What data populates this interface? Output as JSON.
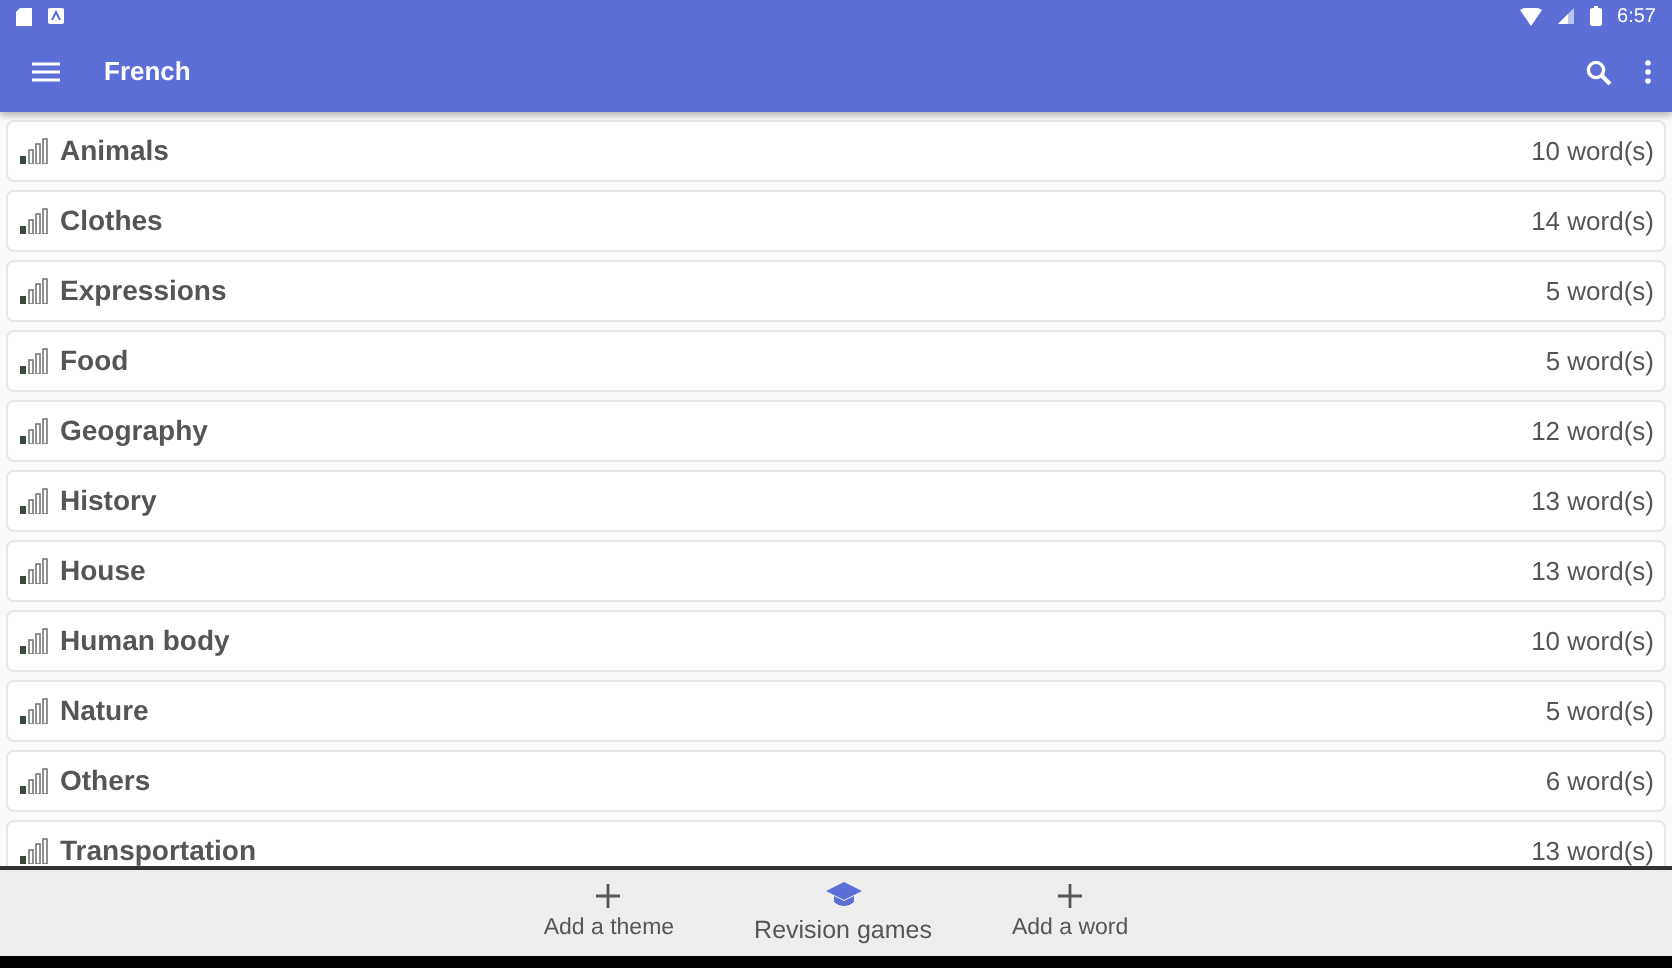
{
  "status_bar": {
    "time": "6:57"
  },
  "app_bar": {
    "title": "French"
  },
  "themes": [
    {
      "name": "Animals",
      "count": "10 word(s)"
    },
    {
      "name": "Clothes",
      "count": "14 word(s)"
    },
    {
      "name": "Expressions",
      "count": "5 word(s)"
    },
    {
      "name": "Food",
      "count": "5 word(s)"
    },
    {
      "name": "Geography",
      "count": "12 word(s)"
    },
    {
      "name": "History",
      "count": "13 word(s)"
    },
    {
      "name": "House",
      "count": "13 word(s)"
    },
    {
      "name": "Human body",
      "count": "10 word(s)"
    },
    {
      "name": "Nature",
      "count": "5 word(s)"
    },
    {
      "name": "Others",
      "count": "6 word(s)"
    },
    {
      "name": "Transportation",
      "count": "13 word(s)"
    }
  ],
  "bottom_nav": [
    {
      "label": "Add a theme",
      "kind": "plus",
      "selected": false
    },
    {
      "label": "Revision games",
      "kind": "cap",
      "selected": true
    },
    {
      "label": "Add a word",
      "kind": "plus",
      "selected": false
    }
  ]
}
